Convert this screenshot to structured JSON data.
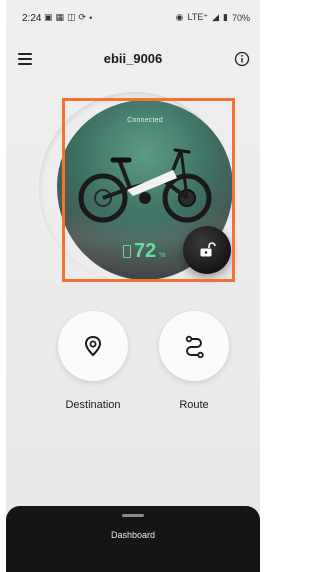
{
  "status_bar": {
    "time": "2:24",
    "network": "LTE⁺",
    "battery": "70%"
  },
  "header": {
    "title": "ebii_9006"
  },
  "bike": {
    "status": "Connected",
    "battery_value": "72",
    "battery_unit": "%"
  },
  "actions": {
    "destination_label": "Destination",
    "route_label": "Route"
  },
  "bottom_sheet": {
    "title": "Dashboard"
  },
  "colors": {
    "accent_green": "#5fe0a0",
    "highlight_orange": "#f3722f",
    "sheet_dark": "#151515"
  },
  "icons": {
    "menu": "menu-icon",
    "info": "info-icon",
    "lock": "unlock-icon",
    "destination": "location-pin-icon",
    "route": "route-icon"
  }
}
